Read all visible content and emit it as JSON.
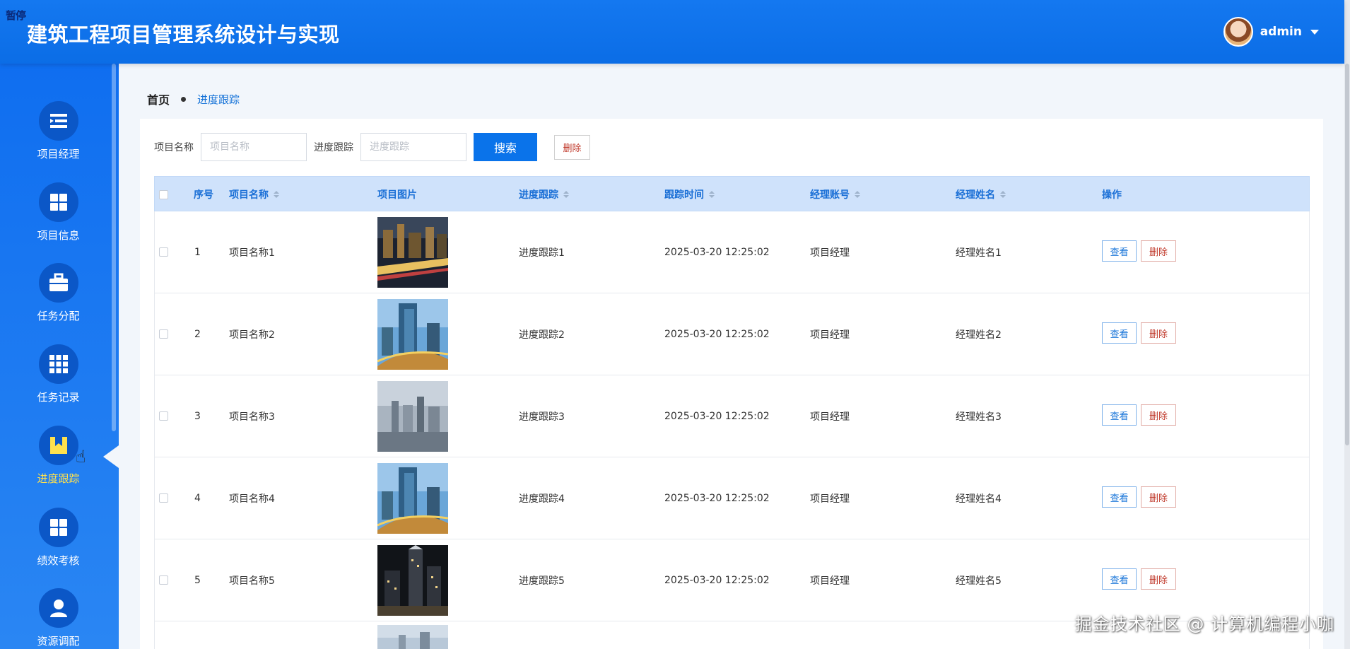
{
  "header": {
    "pause_tag": "暂停",
    "title": "建筑工程项目管理系统设计与实现",
    "username": "admin"
  },
  "sidebar": {
    "items": [
      {
        "label": "项目经理",
        "icon": "list-indent-icon"
      },
      {
        "label": "项目信息",
        "icon": "grid-icon"
      },
      {
        "label": "任务分配",
        "icon": "briefcase-icon"
      },
      {
        "label": "任务记录",
        "icon": "grid-nine-icon"
      },
      {
        "label": "进度跟踪",
        "icon": "flag-icon",
        "active": true
      },
      {
        "label": "绩效考核",
        "icon": "grid-icon"
      },
      {
        "label": "资源调配",
        "icon": "user-icon"
      }
    ]
  },
  "breadcrumb": {
    "home": "首页",
    "current": "进度跟踪"
  },
  "search": {
    "name_label": "项目名称",
    "name_placeholder": "项目名称",
    "track_label": "进度跟踪",
    "track_placeholder": "进度跟踪",
    "search_button": "搜索",
    "delete_button": "删除"
  },
  "table": {
    "headers": {
      "index": "序号",
      "name": "项目名称",
      "image": "项目图片",
      "track": "进度跟踪",
      "time": "跟踪时间",
      "account": "经理账号",
      "manager": "经理姓名",
      "ops": "操作"
    },
    "view_label": "查看",
    "delete_label": "删除",
    "rows": [
      {
        "index": "1",
        "name": "项目名称1",
        "track": "进度跟踪1",
        "time": "2025-03-20 12:25:02",
        "account": "项目经理",
        "manager": "经理姓名1"
      },
      {
        "index": "2",
        "name": "项目名称2",
        "track": "进度跟踪2",
        "time": "2025-03-20 12:25:02",
        "account": "项目经理",
        "manager": "经理姓名2"
      },
      {
        "index": "3",
        "name": "项目名称3",
        "track": "进度跟踪3",
        "time": "2025-03-20 12:25:02",
        "account": "项目经理",
        "manager": "经理姓名3"
      },
      {
        "index": "4",
        "name": "项目名称4",
        "track": "进度跟踪4",
        "time": "2025-03-20 12:25:02",
        "account": "项目经理",
        "manager": "经理姓名4"
      },
      {
        "index": "5",
        "name": "项目名称5",
        "track": "进度跟踪5",
        "time": "2025-03-20 12:25:02",
        "account": "项目经理",
        "manager": "经理姓名5"
      }
    ]
  },
  "watermark": "掘金技术社区 @ 计算机编程小咖",
  "colors": {
    "primary": "#0a73ea",
    "active_menu": "#ffe14d",
    "danger": "#c0392b"
  }
}
